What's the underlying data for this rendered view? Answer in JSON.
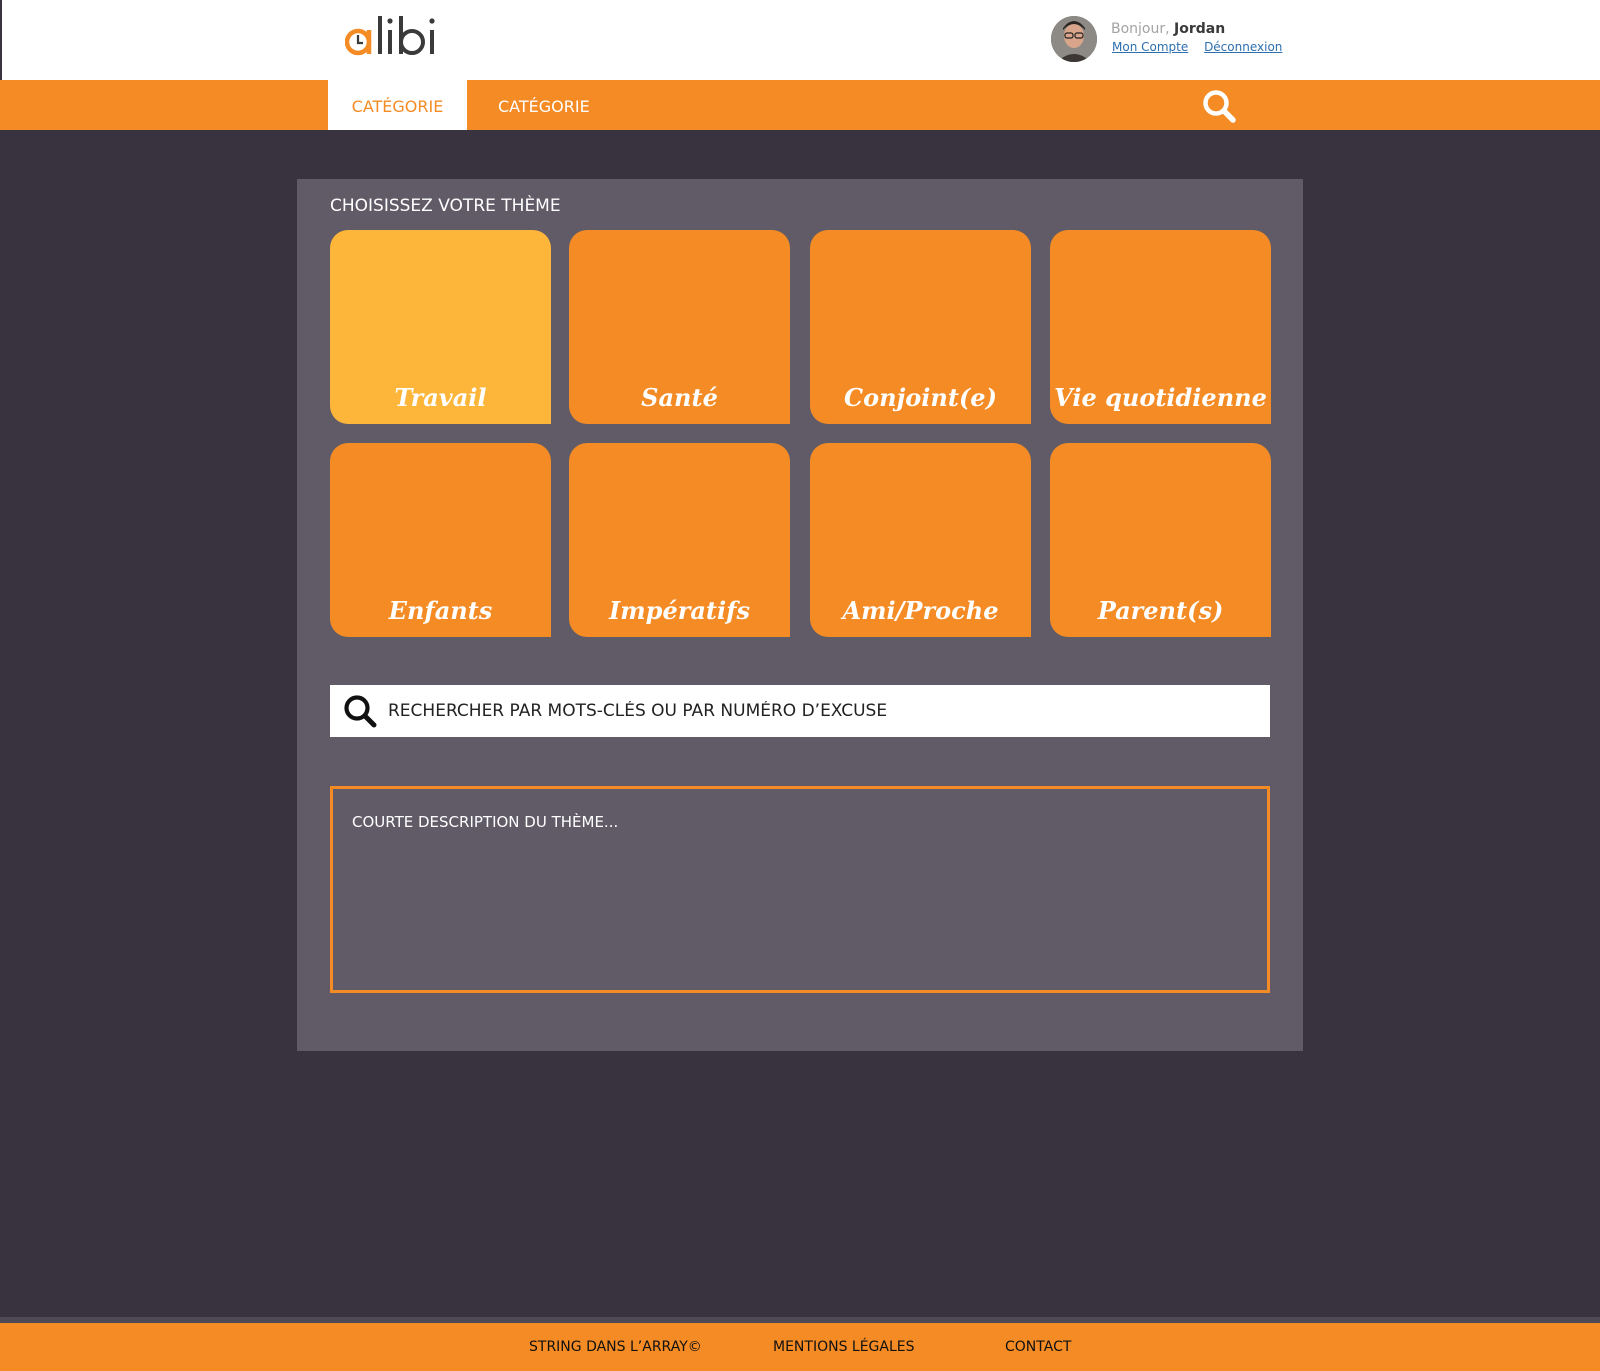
{
  "header": {
    "logo_text": "alibi",
    "greeting_prefix": "Bonjour,",
    "user_name": "Jordan",
    "account_link": "Mon Compte",
    "logout_link": "Déconnexion"
  },
  "nav": {
    "tabs": [
      {
        "label": "Catégorie"
      },
      {
        "label": "Catégorie"
      }
    ]
  },
  "main": {
    "title": "Choisissez votre thème",
    "themes": [
      {
        "label": "Travail",
        "selected": true
      },
      {
        "label": "Santé",
        "selected": false
      },
      {
        "label": "Conjoint(e)",
        "selected": false
      },
      {
        "label": "Vie quotidienne",
        "selected": false
      },
      {
        "label": "Enfants",
        "selected": false
      },
      {
        "label": "Impératifs",
        "selected": false
      },
      {
        "label": "Ami/Proche",
        "selected": false
      },
      {
        "label": "Parent(s)",
        "selected": false
      }
    ],
    "search_placeholder": "Rechercher par mots-clés ou par numéro d’excuse",
    "description": "Courte description du thème..."
  },
  "footer": {
    "links": [
      "String dans l’Array©",
      "Mentions légales",
      "Contact"
    ]
  },
  "colors": {
    "accent": "#f48b24",
    "selected_tile": "#feb63a",
    "background": "#38333f",
    "panel": "#605b67"
  },
  "icons": {
    "nav_search": "search-icon",
    "field_search": "search-icon",
    "logo_clock": "clock-icon"
  }
}
